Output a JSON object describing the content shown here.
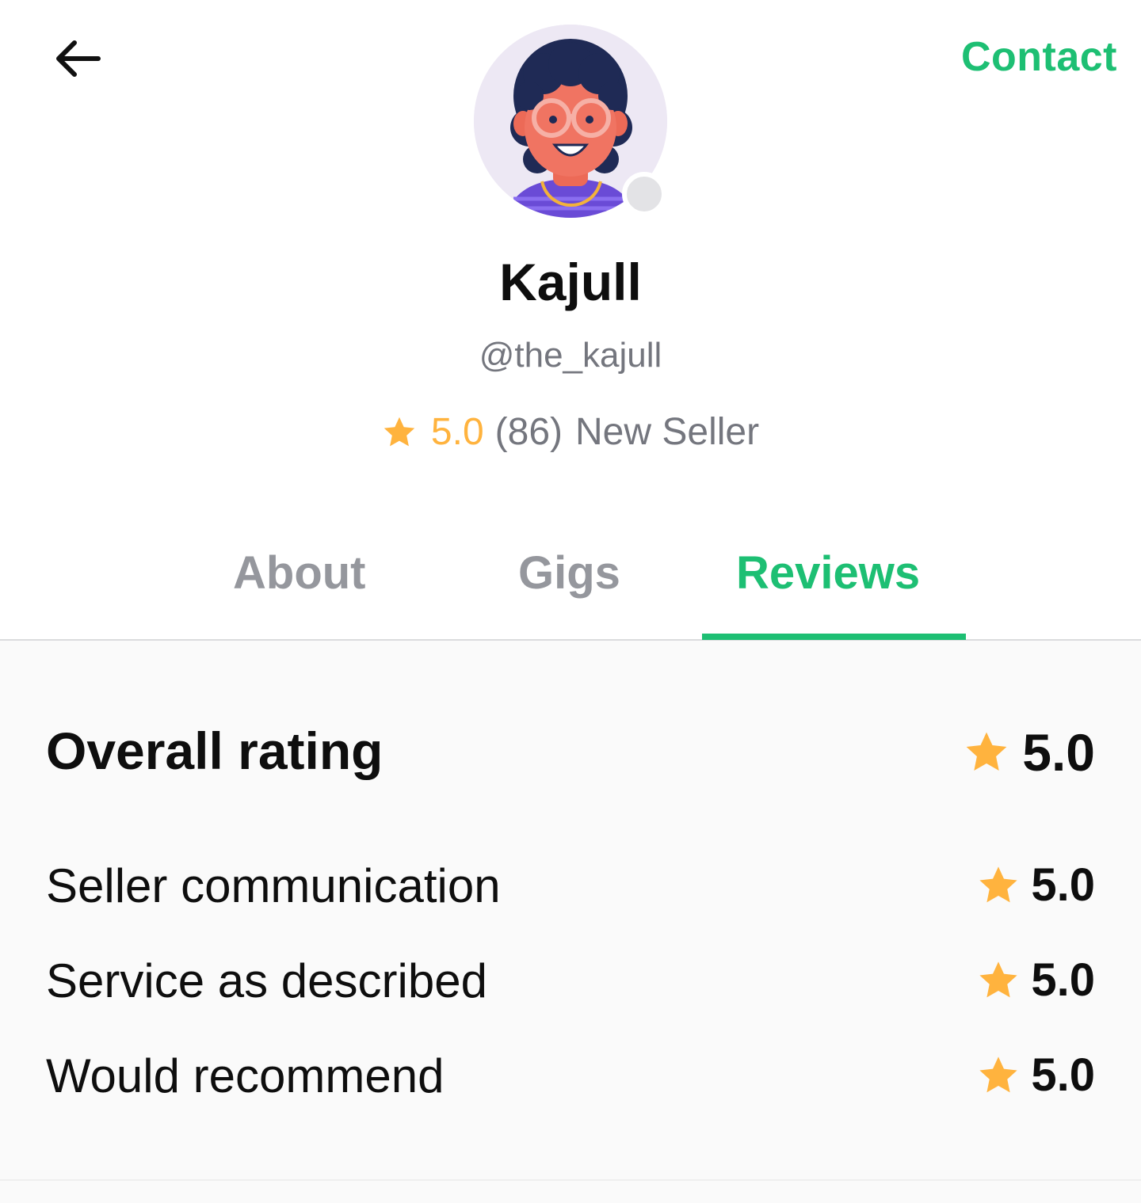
{
  "header": {
    "back_icon": "arrow-left-icon",
    "contact_label": "Contact"
  },
  "profile": {
    "avatar_icon": "avatar-illustration",
    "online_status": "offline",
    "name": "Kajull",
    "handle": "@the_kajull",
    "rating": "5.0",
    "review_count": "(86)",
    "seller_level": "New Seller"
  },
  "tabs": [
    {
      "label": "About",
      "active": false
    },
    {
      "label": "Gigs",
      "active": false
    },
    {
      "label": "Reviews",
      "active": true
    }
  ],
  "reviews": {
    "overall_label": "Overall rating",
    "overall_score": "5.0",
    "breakdown": [
      {
        "label": "Seller communication",
        "score": "5.0"
      },
      {
        "label": "Service as described",
        "score": "5.0"
      },
      {
        "label": "Would recommend",
        "score": "5.0"
      }
    ]
  },
  "colors": {
    "accent": "#1dbf73",
    "star": "#ffb33e",
    "muted_text": "#74767e",
    "tab_inactive": "#95979d",
    "panel_bg": "#fafafa"
  }
}
